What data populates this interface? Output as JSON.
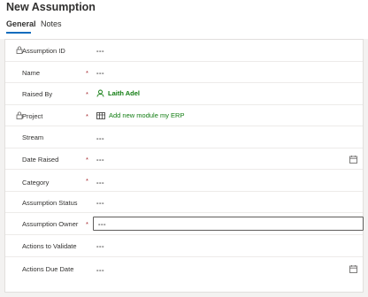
{
  "header": {
    "title": "New Assumption",
    "tabs": [
      {
        "label": "General",
        "active": true
      },
      {
        "label": "Notes",
        "active": false
      }
    ]
  },
  "form": {
    "fields": [
      {
        "label": "Assumption ID",
        "value": "---",
        "required": false,
        "locked": true
      },
      {
        "label": "Name",
        "value": "---",
        "required": true
      },
      {
        "label": "Raised By",
        "value": "Laith Adel",
        "required": true,
        "lookup_icon": "person-icon"
      },
      {
        "label": "Project",
        "value": "Add new module my ERP",
        "required": true,
        "locked": true,
        "lookup_icon": "table-icon"
      },
      {
        "label": "Stream",
        "value": "---",
        "required": false
      },
      {
        "label": "Date Raised",
        "value": "---",
        "required": true,
        "trailing_icon": "calendar-icon"
      },
      {
        "label": "Category",
        "value": "---",
        "required": true
      },
      {
        "label": "Assumption Status",
        "value": "---",
        "required": false
      },
      {
        "label": "Assumption Owner",
        "value": "---",
        "required": true,
        "focused": true
      },
      {
        "label": "Actions to Validate",
        "value": "---",
        "required": false
      },
      {
        "label": "Actions Due Date",
        "value": "---",
        "required": false,
        "trailing_icon": "calendar-icon"
      }
    ],
    "required_marker": "*"
  },
  "colors": {
    "accent": "#0f6cbd",
    "required": "#a4262c",
    "lookup_link": "#107c10"
  }
}
